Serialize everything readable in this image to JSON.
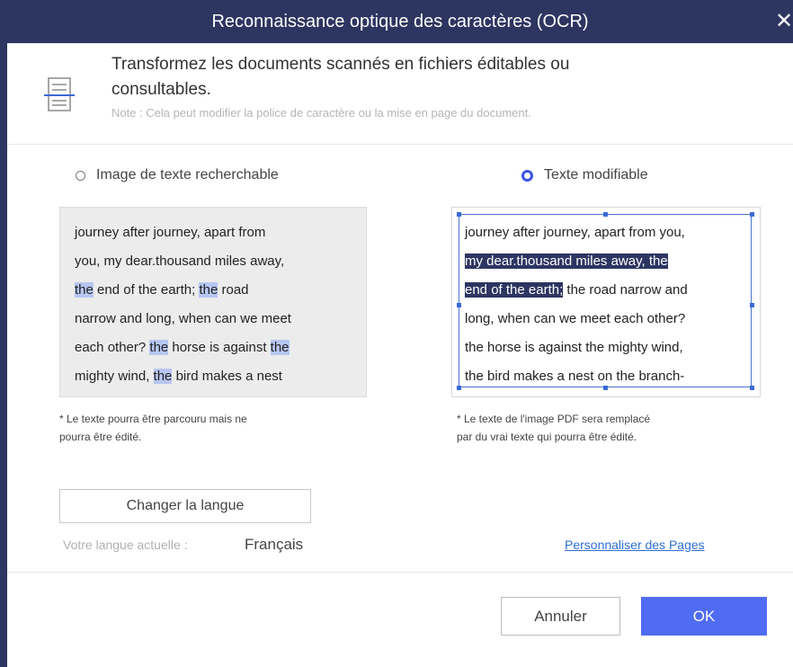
{
  "window": {
    "title": "Reconnaissance optique des caractères (OCR)",
    "close_glyph": "✕"
  },
  "header": {
    "icon": "document-icon",
    "line1": "Transformez les documents scannés en fichiers éditables ou",
    "line2": "consultables.",
    "note": "Note : Cela peut modifier la police de caractère ou la mise en page du document."
  },
  "options": {
    "left": {
      "label": "Image de texte recherchable",
      "selected": false
    },
    "right": {
      "label": "Texte modifiable",
      "selected": true
    }
  },
  "left_sample": {
    "lines": [
      "journey after journey, apart from",
      "you, my dear.thousand miles away,",
      "the end of the earth; the road",
      "narrow and long, when can we meet",
      "each other? the horse is against the",
      "mighty wind, the bird makes a nest"
    ],
    "highlight_word": "the"
  },
  "right_sample": {
    "lines": [
      "journey after journey, apart from you,",
      "my dear.thousand miles away, the",
      "end of the earth; the road narrow and",
      "long, when can we meet each other?",
      "the horse is against the mighty wind,",
      "the bird makes a nest on the branch-"
    ]
  },
  "captions": {
    "left_1": "* Le texte pourra être parcouru mais ne",
    "left_2": "pourra être édité.",
    "right_1": "* Le texte de l'image PDF sera remplacé",
    "right_2": "par du vrai texte qui pourra être édité."
  },
  "language": {
    "button": "Changer la langue",
    "label": "Votre langue actuelle :",
    "value": "Français"
  },
  "link": "Personnaliser des Pages",
  "buttons": {
    "cancel": "Annuler",
    "ok": "OK"
  },
  "colors": {
    "titlebar": "#2d3561",
    "accent": "#4f6cf2",
    "highlight": "#b7c6f2",
    "selection": "#2d3561"
  }
}
